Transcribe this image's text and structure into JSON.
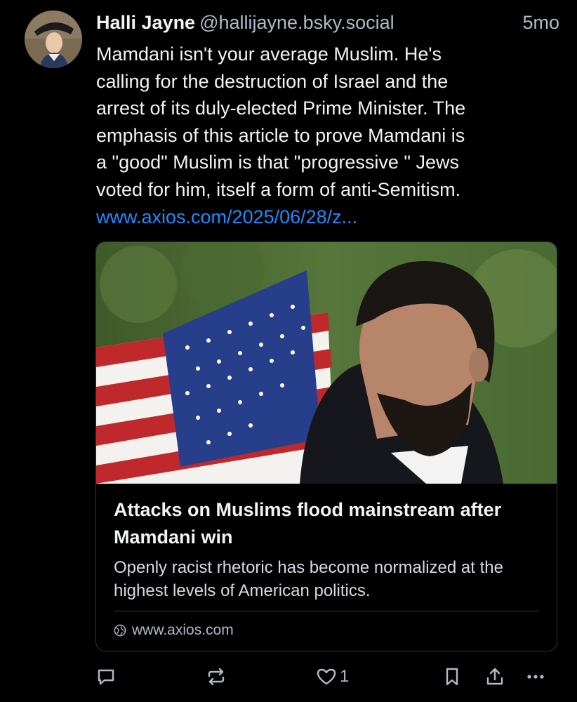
{
  "post": {
    "author_name": "Halli Jayne",
    "author_handle": "@hallijayne.bsky.social",
    "time": "5mo",
    "text": "Mamdani isn't  your average Muslim. He's\ncalling for the destruction of Israel and the\narrest of its duly-elected Prime Minister. The\nemphasis of this article to prove Mamdani is\na \"good\" Muslim is that \"progressive \" Jews\nvoted for him, itself a form of anti-Semitism.",
    "link_text": "www.axios.com/2025/06/28/z..."
  },
  "card": {
    "title": "Attacks on Muslims flood mainstream after Mamdani win",
    "description": "Openly racist rhetoric has become normalized at the highest levels of American politics.",
    "domain": "www.axios.com"
  },
  "actions": {
    "like_count": "1"
  },
  "icons": {
    "avatar": "avatar-portrait",
    "card_image": "man-with-american-flag-photo",
    "domain": "globe-icon",
    "reply": "speech-bubble-icon",
    "repost": "repost-arrows-icon",
    "like": "heart-icon",
    "bookmark": "bookmark-icon",
    "share": "share-icon",
    "more": "ellipsis-icon"
  },
  "colors": {
    "background": "#000000",
    "text": "#f1f3f5",
    "muted": "#aebbc9",
    "link": "#208bfe",
    "border": "#2e3640"
  }
}
